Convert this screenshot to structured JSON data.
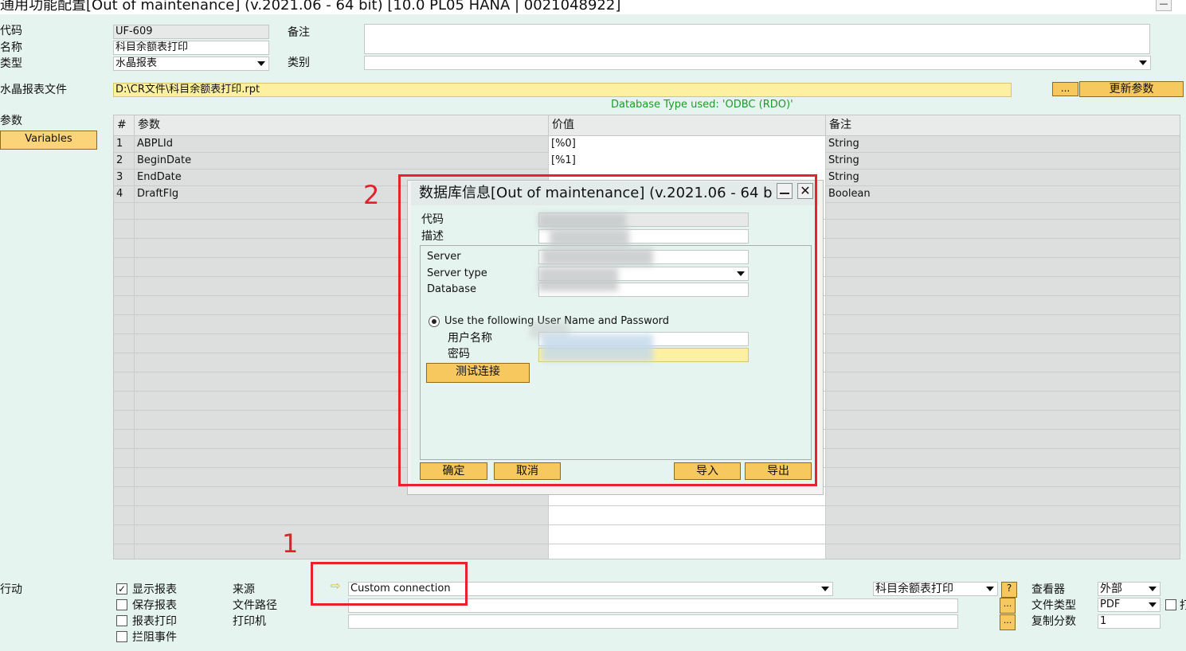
{
  "window": {
    "title": "通用功能配置[Out of maintenance]  (v.2021.06 - 64 bit) [10.0 PL05 HANA | 0021048922]",
    "minimize": "—"
  },
  "form": {
    "code_label": "代码",
    "code_value": "UF-609",
    "name_label": "名称",
    "name_value": "科目余额表打印",
    "type_label": "类型",
    "type_value": "水晶报表",
    "remark_label": "备注",
    "remark_value": "",
    "category_label": "类别",
    "category_value": "",
    "crystal_file_label": "水晶报表文件",
    "crystal_file_value": "D:\\CR文件\\科目余额表打印.rpt",
    "ellipsis": "...",
    "update_params_button": "更新参数",
    "db_type_note": "Database Type used: 'ODBC (RDO)'",
    "params_label": "参数",
    "variables_button": "Variables"
  },
  "grid": {
    "headers": [
      "#",
      "参数",
      "价值",
      "备注"
    ],
    "rows": [
      {
        "num": "1",
        "param": "ABPLId",
        "value": "[%0]",
        "note": "String"
      },
      {
        "num": "2",
        "param": "BeginDate",
        "value": "[%1]",
        "note": "String"
      },
      {
        "num": "3",
        "param": "EndDate",
        "value": "",
        "note": "String"
      },
      {
        "num": "4",
        "param": "DraftFlg",
        "value": "",
        "note": "Boolean"
      }
    ]
  },
  "dialog": {
    "title": "数据库信息[Out of maintenance]  (v.2021.06 - 64 b",
    "code_label": "代码",
    "desc_label": "描述",
    "server_label": "Server",
    "server_type_label": "Server type",
    "database_label": "Database",
    "radio_label": "Use the following User Name and Password",
    "username_label": "用户名称",
    "password_label": "密码",
    "test_button": "测试连接",
    "ok_button": "确定",
    "cancel_button": "取消",
    "import_button": "导入",
    "export_button": "导出"
  },
  "bottom": {
    "action_label": "行动",
    "checkboxes": [
      {
        "label": "显示报表",
        "checked": true
      },
      {
        "label": "保存报表",
        "checked": false
      },
      {
        "label": "报表打印",
        "checked": false
      },
      {
        "label": "拦阻事件",
        "checked": false
      }
    ],
    "source_label": "来源",
    "filepath_label": "文件路径",
    "printer_label": "打印机",
    "source_value": "Custom connection",
    "report_select": "科目余额表打印",
    "help": "?",
    "viewer_label": "查看器",
    "viewer_value": "外部",
    "filetype_label": "文件类型",
    "filetype_value": "PDF",
    "copies_label": "复制分数",
    "copies_value": "1",
    "truncated_label": "打"
  },
  "annotations": {
    "num1": "1",
    "num2": "2",
    "color": "#e8212a"
  }
}
